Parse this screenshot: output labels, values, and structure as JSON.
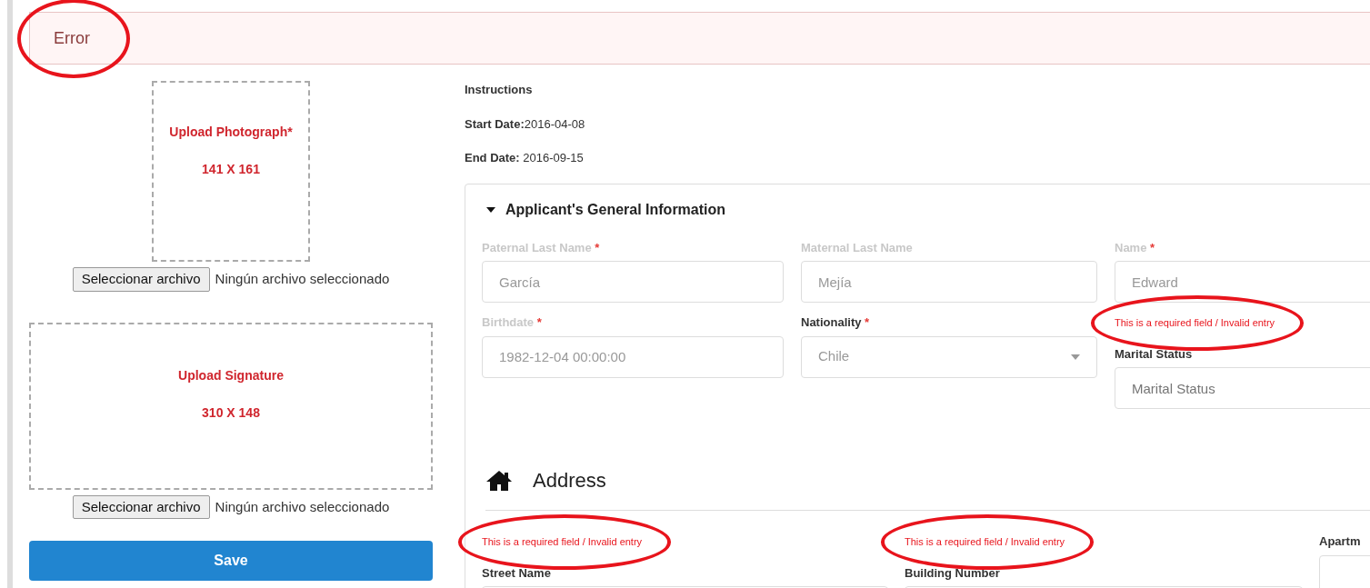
{
  "alert": {
    "title": "Error",
    "circled": true
  },
  "uploads": [
    {
      "kind": "photo",
      "title": "Upload Photograph*",
      "size": "141 X 161",
      "button": "Seleccionar archivo",
      "file_status": "Ningún archivo seleccionado"
    },
    {
      "kind": "signature",
      "title": "Upload Signature",
      "size": "310 X 148",
      "button": "Seleccionar archivo",
      "file_status": "Ningún archivo seleccionado"
    }
  ],
  "save_button": "Save",
  "info": [
    {
      "kind": "heading",
      "text": "Instructions"
    },
    {
      "kind": "line",
      "text": "**Start Date:**2016-04-08"
    },
    {
      "kind": "line",
      "text": "**End Date:** 2016-09-15"
    }
  ],
  "section": {
    "title": "Applicant's General Information",
    "expanded": true,
    "fields": [
      {
        "kind": "input",
        "label": "Paternal Last Name",
        "required_mark": "*",
        "disabled": true,
        "value": "García"
      },
      {
        "kind": "input",
        "label": "Maternal Last Name",
        "disabled": true,
        "value": "Mejía"
      },
      {
        "kind": "input",
        "label": "Name",
        "required_mark": "*",
        "disabled": true,
        "value": "Edward"
      },
      {
        "kind": "input",
        "label": "Birthdate",
        "required_mark": "*",
        "disabled": true,
        "value": "1982-12-04 00:00:00"
      },
      {
        "kind": "select",
        "label": "Nationality",
        "required_mark": "*",
        "disabled": false,
        "value": "Chile"
      },
      {
        "kind": "input",
        "label": "Marital Status",
        "disabled": false,
        "placeholder": "Marital Status",
        "error": "This is a required field / Invalid entry",
        "circled": true
      }
    ]
  },
  "address": {
    "title": "Address",
    "fields": [
      {
        "kind": "input",
        "label": "Street Name",
        "disabled": false,
        "error": "This is a required field / Invalid entry",
        "circled": true
      },
      {
        "kind": "input",
        "label": "Building Number",
        "disabled": false,
        "error": "This is a required field / Invalid entry",
        "circled": true
      },
      {
        "kind": "input",
        "label": "Apartm",
        "disabled": false
      }
    ]
  }
}
